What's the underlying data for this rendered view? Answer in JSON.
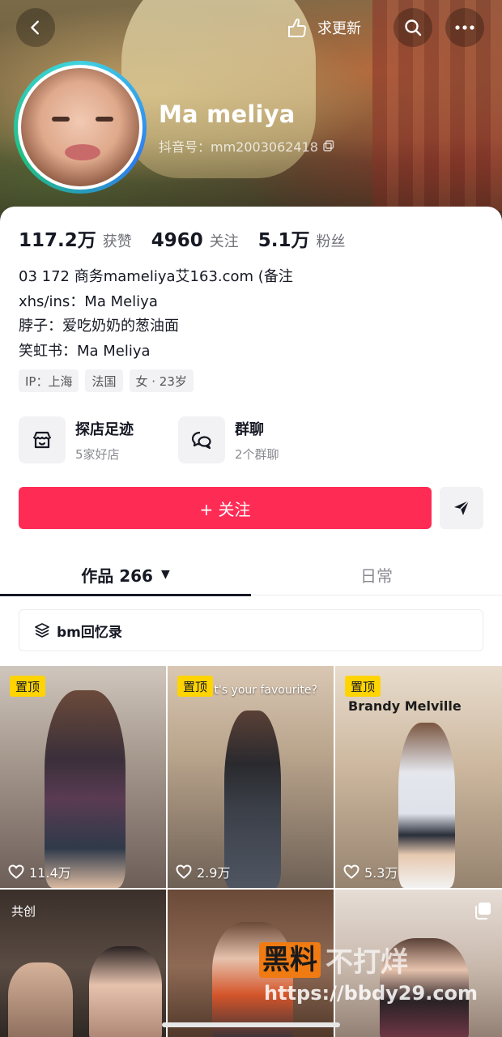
{
  "header": {
    "update_label": "求更新",
    "nickname": "Ma meliya",
    "douyin_id": "抖音号：mm2003062418"
  },
  "stats": [
    {
      "value": "117.2万",
      "label": "获赞"
    },
    {
      "value": "4960",
      "label": "关注"
    },
    {
      "value": "5.1万",
      "label": "粉丝"
    }
  ],
  "bio": [
    "03 172  商务mameliya艾163.com (备注",
    "xhs/ins：Ma Meliya",
    "脖子：爱吃奶奶的葱油面",
    "笑虹书：Ma Meliya"
  ],
  "tags": [
    "IP：上海",
    "法国",
    "女 · 23岁"
  ],
  "features": {
    "shop": {
      "title": "探店足迹",
      "subtitle": "5家好店"
    },
    "group": {
      "title": "群聊",
      "subtitle": "2个群聊"
    }
  },
  "follow_button": "+ 关注",
  "tabs": {
    "works": "作品 266",
    "daily": "日常"
  },
  "collection": "bm回忆录",
  "videos": [
    {
      "badge": "置顶",
      "likes": "11.4万"
    },
    {
      "badge": "置顶",
      "likes": "2.9万",
      "caption": "hat's your favourite?"
    },
    {
      "badge": "置顶",
      "likes": "5.3万",
      "caption": "Brandy Melville"
    },
    {
      "badge": "共创"
    },
    {},
    {}
  ],
  "watermark": {
    "box": "黑料",
    "text": "不打烊",
    "url": "https://bbdy29.com"
  },
  "colors": {
    "primary": "#fe2c55",
    "pin_badge": "#ffd400",
    "text_primary": "#161823",
    "text_secondary": "#8a8b91"
  }
}
